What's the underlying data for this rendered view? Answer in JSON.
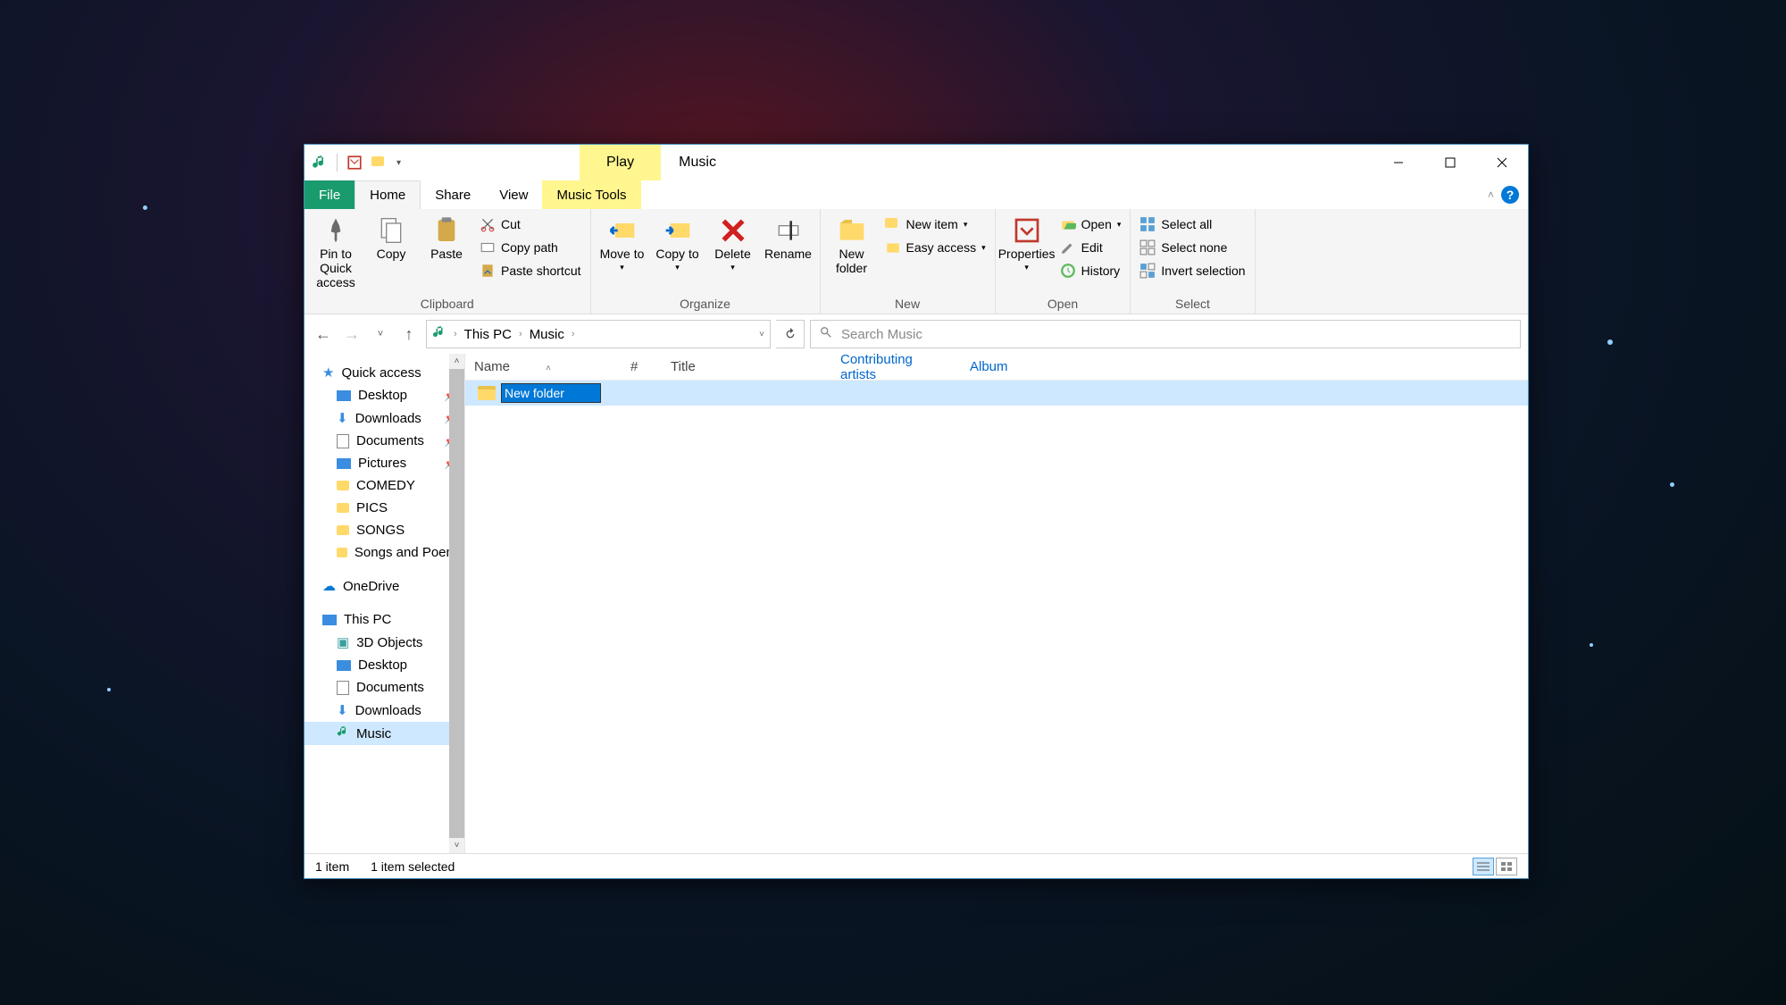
{
  "titlebar": {
    "play_tab": "Play",
    "title": "Music"
  },
  "tabs": {
    "file": "File",
    "home": "Home",
    "share": "Share",
    "view": "View",
    "music_tools": "Music Tools"
  },
  "ribbon": {
    "clipboard": {
      "label": "Clipboard",
      "pin": "Pin to Quick access",
      "copy": "Copy",
      "paste": "Paste",
      "cut": "Cut",
      "copy_path": "Copy path",
      "paste_shortcut": "Paste shortcut"
    },
    "organize": {
      "label": "Organize",
      "move_to": "Move to",
      "copy_to": "Copy to",
      "delete": "Delete",
      "rename": "Rename"
    },
    "new": {
      "label": "New",
      "new_folder": "New folder",
      "new_item": "New item",
      "easy_access": "Easy access"
    },
    "open": {
      "label": "Open",
      "properties": "Properties",
      "open": "Open",
      "edit": "Edit",
      "history": "History"
    },
    "select": {
      "label": "Select",
      "select_all": "Select all",
      "select_none": "Select none",
      "invert": "Invert selection"
    }
  },
  "address": {
    "this_pc": "This PC",
    "music": "Music",
    "search_placeholder": "Search Music"
  },
  "nav": {
    "quick_access": "Quick access",
    "desktop": "Desktop",
    "downloads": "Downloads",
    "documents": "Documents",
    "pictures": "Pictures",
    "comedy": "COMEDY",
    "pics": "PICS",
    "songs": "SONGS",
    "songs_and_poems": "Songs and Poem",
    "onedrive": "OneDrive",
    "this_pc": "This PC",
    "objects_3d": "3D Objects",
    "desktop2": "Desktop",
    "documents2": "Documents",
    "downloads2": "Downloads",
    "music": "Music"
  },
  "columns": {
    "name": "Name",
    "num": "#",
    "title": "Title",
    "artists": "Contributing artists",
    "album": "Album"
  },
  "content": {
    "new_folder_name": "New folder"
  },
  "status": {
    "items": "1 item",
    "selected": "1 item selected"
  }
}
